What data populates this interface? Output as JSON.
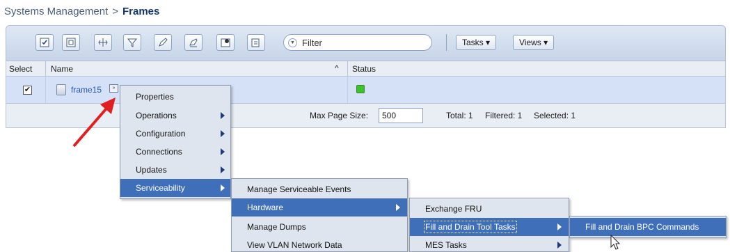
{
  "breadcrumb": {
    "parent": "Systems Management",
    "separator": ">",
    "current": "Frames"
  },
  "toolbar": {
    "filter_placeholder": "Filter",
    "tasks_label": "Tasks ▾",
    "views_label": "Views ▾"
  },
  "table": {
    "columns": {
      "select": "Select",
      "name": "Name",
      "sort_indicator": "^",
      "status": "Status"
    },
    "rows": [
      {
        "checked": "✔",
        "name": "frame15",
        "status_color": "#3fc12e"
      }
    ],
    "footer": {
      "max_page_label": "Max Page Size:",
      "max_page_value": "500",
      "total": "Total: 1",
      "filtered": "Filtered: 1",
      "selected": "Selected: 1"
    }
  },
  "context_menu": {
    "items": [
      {
        "label": "Properties",
        "submenu": false
      },
      {
        "label": "Operations",
        "submenu": true
      },
      {
        "label": "Configuration",
        "submenu": true
      },
      {
        "label": "Connections",
        "submenu": true
      },
      {
        "label": "Updates",
        "submenu": true
      },
      {
        "label": "Serviceability",
        "submenu": true,
        "highlighted": true
      }
    ]
  },
  "serviceability_menu": {
    "items": [
      {
        "label": "Manage Serviceable Events",
        "submenu": false
      },
      {
        "label": "Hardware",
        "submenu": true,
        "highlighted": true
      },
      {
        "label": "Manage Dumps",
        "submenu": false
      },
      {
        "label": "View VLAN Network Data",
        "submenu": false
      }
    ]
  },
  "hardware_menu": {
    "items": [
      {
        "label": "Exchange FRU",
        "submenu": false
      },
      {
        "label": "Fill and Drain Tool Tasks",
        "submenu": true,
        "highlighted": true
      },
      {
        "label": "MES Tasks",
        "submenu": true
      }
    ]
  },
  "fill_drain_menu": {
    "items": [
      {
        "label": "Fill and Drain BPC Commands",
        "submenu": false,
        "highlighted": true
      }
    ]
  },
  "colors": {
    "accent": "#3f6fb8",
    "status_ok": "#3fc12e",
    "arrow": "#e02020"
  },
  "icons": [
    "checkbox-icon",
    "frame-icon",
    "context-menu-icon",
    "status-ok-icon",
    "pointer-cursor-icon",
    "red-annotation-arrow"
  ]
}
